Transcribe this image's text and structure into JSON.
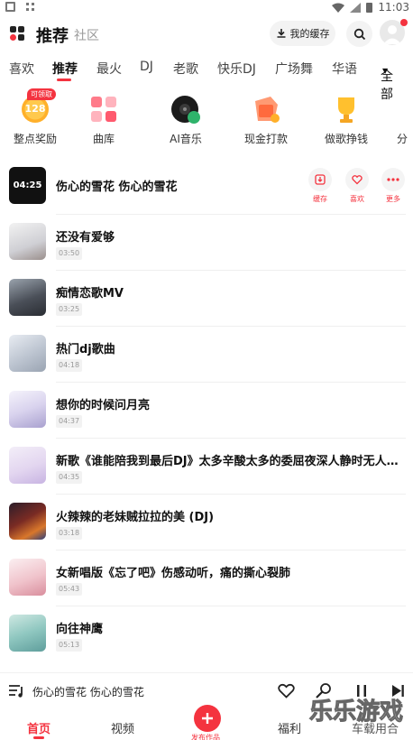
{
  "status_bar": {
    "time": "11:03"
  },
  "header": {
    "title": "推荐",
    "subtitle": "社区",
    "cache_label": "我的缓存"
  },
  "tabs": [
    "喜欢",
    "推荐",
    "最火",
    "DJ",
    "老歌",
    "快乐DJ",
    "广场舞",
    "华语"
  ],
  "tab_all": "全部",
  "quick_entries": [
    {
      "label": "整点奖励",
      "icon": "reward-coin-icon",
      "badge": "可领取",
      "value": "128"
    },
    {
      "label": "曲库",
      "icon": "music-library-icon"
    },
    {
      "label": "AI音乐",
      "icon": "ai-music-disc-icon"
    },
    {
      "label": "现金打款",
      "icon": "cash-payout-icon"
    },
    {
      "label": "做歌挣钱",
      "icon": "trophy-ai-icon"
    }
  ],
  "songs": [
    {
      "title": "伤心的雪花 伤心的雪花",
      "duration": "04:25",
      "playing": true
    },
    {
      "title": "还没有爱够",
      "duration": "03:50"
    },
    {
      "title": "痴情恋歌MV",
      "duration": "03:25"
    },
    {
      "title": "热门dj歌曲",
      "duration": "04:18"
    },
    {
      "title": "想你的时候问月亮",
      "duration": "04:37"
    },
    {
      "title": "新歌《谁能陪我到最后DJ》太多辛酸太多的委屈夜深人静时无人倾诉",
      "duration": "04:35"
    },
    {
      "title": "火辣辣的老妹贼拉拉的美 (DJ)",
      "duration": "03:18"
    },
    {
      "title": "女新唱版《忘了吧》伤感动听，痛的撕心裂肺",
      "duration": "05:43"
    },
    {
      "title": "向往神鹰",
      "duration": "05:13"
    }
  ],
  "row_actions": {
    "cache": "缓存",
    "like": "喜欢",
    "more": "更多"
  },
  "player": {
    "song": "伤心的雪花 伤心的雪花"
  },
  "bottom_nav": {
    "home": "首页",
    "video": "视频",
    "publish": "发布作品",
    "welfare": "福利",
    "watermark": "乐乐游戏"
  },
  "colors": {
    "accent": "#f4333f"
  }
}
